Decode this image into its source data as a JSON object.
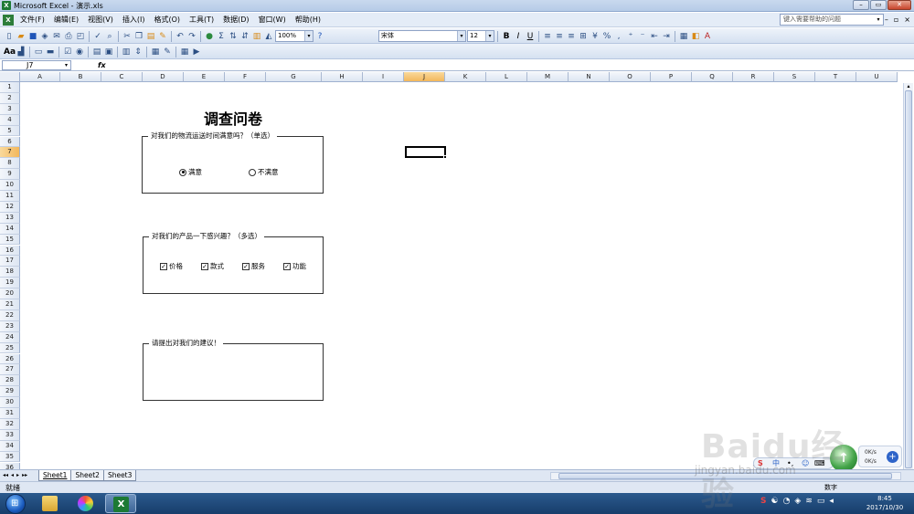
{
  "window": {
    "title": "Microsoft Excel - 演示.xls",
    "min": "–",
    "restore": "▭",
    "close": "✕"
  },
  "menubar": {
    "items": [
      "文件(F)",
      "编辑(E)",
      "视图(V)",
      "插入(I)",
      "格式(O)",
      "工具(T)",
      "数据(D)",
      "窗口(W)",
      "帮助(H)"
    ],
    "help_placeholder": "键入需要帮助的问题",
    "doc_min": "–",
    "doc_restore": "▫",
    "doc_close": "×"
  },
  "toolbar": {
    "zoom": "100%",
    "font": "宋体",
    "font_size": "12",
    "bold": "B",
    "italic": "I",
    "underline": "U",
    "sigma": "Σ",
    "percent": "%"
  },
  "formula": {
    "name_box": "J7",
    "fx": "fx",
    "content": ""
  },
  "grid": {
    "columns": [
      "A",
      "B",
      "C",
      "D",
      "E",
      "F",
      "G",
      "H",
      "I",
      "J",
      "K",
      "L",
      "M",
      "N",
      "O",
      "P",
      "Q",
      "R",
      "S",
      "T",
      "U"
    ],
    "rows": [
      "1",
      "2",
      "3",
      "4",
      "5",
      "6",
      "7",
      "8",
      "9",
      "10",
      "11",
      "12",
      "13",
      "14",
      "15",
      "16",
      "17",
      "18",
      "19",
      "20",
      "21",
      "22",
      "23",
      "24",
      "25",
      "26",
      "27",
      "28",
      "29",
      "30",
      "31",
      "32",
      "33",
      "34",
      "35",
      "36"
    ],
    "selected_column": "J",
    "selected_row": "7"
  },
  "survey": {
    "title": "调查问卷",
    "q1": {
      "legend": "对我们的物流运送时间满意吗？（单选）",
      "options": [
        {
          "label": "满意",
          "checked": true
        },
        {
          "label": "不满意",
          "checked": false
        }
      ]
    },
    "q2": {
      "legend": "对我们的产品一下感兴趣？（多选）",
      "options": [
        {
          "label": "价格",
          "checked": true
        },
        {
          "label": "款式",
          "checked": true
        },
        {
          "label": "服务",
          "checked": true
        },
        {
          "label": "功能",
          "checked": true
        }
      ]
    },
    "q3": {
      "legend": "请提出对我们的建议！"
    },
    "check_mark": "✓"
  },
  "sheets": {
    "nav": [
      "◂◂",
      "◂",
      "▸",
      "▸▸"
    ],
    "tabs": [
      "Sheet1",
      "Sheet2",
      "Sheet3"
    ],
    "active": "Sheet1"
  },
  "status": {
    "ready": "就绪",
    "numlock": "数字"
  },
  "floatwidget": {
    "speed_up": "0K/s",
    "speed_down": "0K/s",
    "plus": "+",
    "badge": "S"
  },
  "taskbar": {
    "time": "8:45",
    "date": "2017/10/30"
  },
  "watermark": {
    "text": "Baidu经验",
    "url": "jingyan.baidu.com"
  },
  "colors": {
    "selection": "#f3b75b",
    "excel_green": "#1d7a34",
    "taskbar": "#173d6b"
  }
}
